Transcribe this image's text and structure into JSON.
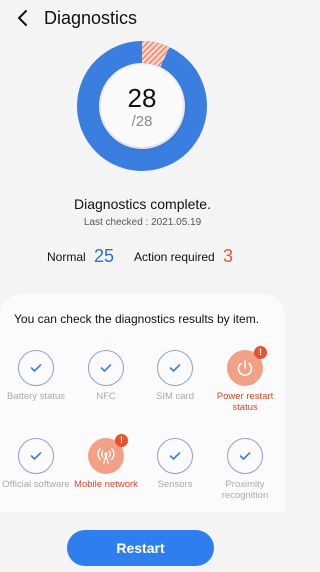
{
  "header": {
    "title": "Diagnostics",
    "back_icon": "chevron-left-icon"
  },
  "summary": {
    "passed": "28",
    "total": "/28",
    "passed_fraction": 0.93,
    "ring_color": "#3a7fe0",
    "warning_color": "#e8522e",
    "status_title": "Diagnostics complete.",
    "last_checked": "Last checked : 2021.05.19",
    "normal_label": "Normal",
    "normal_value": "25",
    "normal_color": "#2a6fd6",
    "action_label": "Action required",
    "action_value": "3",
    "action_color": "#e8522e"
  },
  "card": {
    "instruction": "You can check the diagnostics results by item.",
    "items": [
      {
        "label": "Battery status",
        "state": "ok",
        "icon": "check-icon"
      },
      {
        "label": "NFC",
        "state": "ok",
        "icon": "check-icon"
      },
      {
        "label": "SIM card",
        "state": "ok",
        "icon": "check-icon"
      },
      {
        "label": "Power restart status",
        "state": "warn",
        "icon": "power-restart-icon",
        "badge": "!"
      },
      {
        "label": "Official software",
        "state": "ok",
        "icon": "check-icon"
      },
      {
        "label": "Mobile network",
        "state": "warn",
        "icon": "signal-tower-icon",
        "badge": "!"
      },
      {
        "label": "Sensors",
        "state": "ok",
        "icon": "check-icon"
      },
      {
        "label": "Proximity recognition",
        "state": "ok",
        "icon": "check-icon"
      }
    ]
  },
  "footer": {
    "restart_label": "Restart",
    "button_color": "#2f7ef0"
  }
}
